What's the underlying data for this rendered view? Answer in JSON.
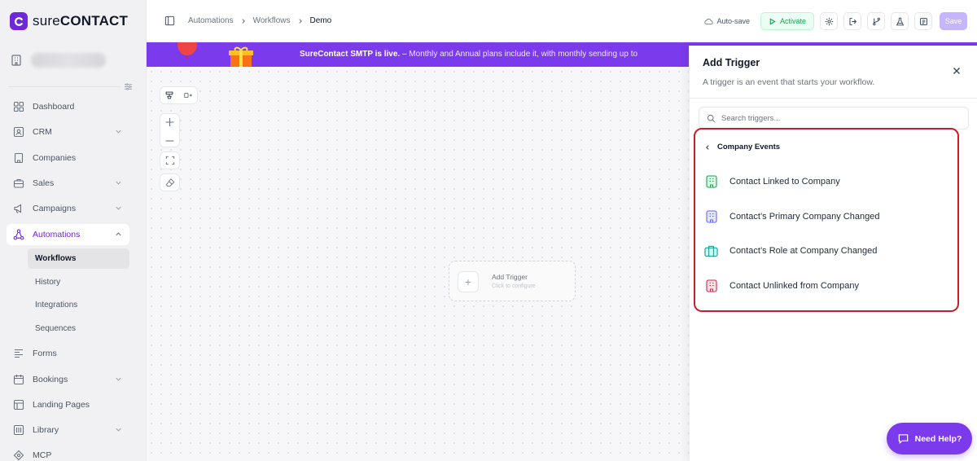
{
  "brand": {
    "name_prefix": "sure",
    "name_suffix": "CONTACT"
  },
  "sidebar": {
    "items": [
      {
        "label": "Dashboard"
      },
      {
        "label": "CRM"
      },
      {
        "label": "Companies"
      },
      {
        "label": "Sales"
      },
      {
        "label": "Campaigns"
      },
      {
        "label": "Automations"
      },
      {
        "label": "Forms"
      },
      {
        "label": "Bookings"
      },
      {
        "label": "Landing Pages"
      },
      {
        "label": "Library"
      },
      {
        "label": "MCP"
      }
    ],
    "subitems": [
      {
        "label": "Workflows"
      },
      {
        "label": "History"
      },
      {
        "label": "Integrations"
      },
      {
        "label": "Sequences"
      }
    ]
  },
  "breadcrumb": [
    "Automations",
    "Workflows",
    "Demo"
  ],
  "toolbar": {
    "autosave_label": "Auto-save",
    "activate_label": "Activate",
    "save_label": "Save"
  },
  "banner": {
    "bold": "SureContact SMTP is live.",
    "text": " – Monthly and Annual plans include it, with monthly sending up to "
  },
  "canvas": {
    "trigger_title": "Add Trigger",
    "trigger_sub": "Click to configure"
  },
  "panel": {
    "title": "Add Trigger",
    "description": "A trigger is an event that starts your workflow.",
    "search_placeholder": "Search triggers...",
    "group_label": "Company Events",
    "triggers": [
      {
        "label": "Contact Linked to Company",
        "icon": "building-icon",
        "color": "#16a34a"
      },
      {
        "label": "Contact’s Primary Company Changed",
        "icon": "building-icon",
        "color": "#6366f1"
      },
      {
        "label": "Contact’s Role at Company Changed",
        "icon": "briefcase-icon",
        "color": "#0d9488"
      },
      {
        "label": "Contact Unlinked from Company",
        "icon": "building-icon",
        "color": "#e11d48"
      }
    ]
  },
  "help": {
    "label": "Need Help?"
  },
  "colors": {
    "accent": "#7c3aed",
    "highlight": "#c81e2c"
  }
}
